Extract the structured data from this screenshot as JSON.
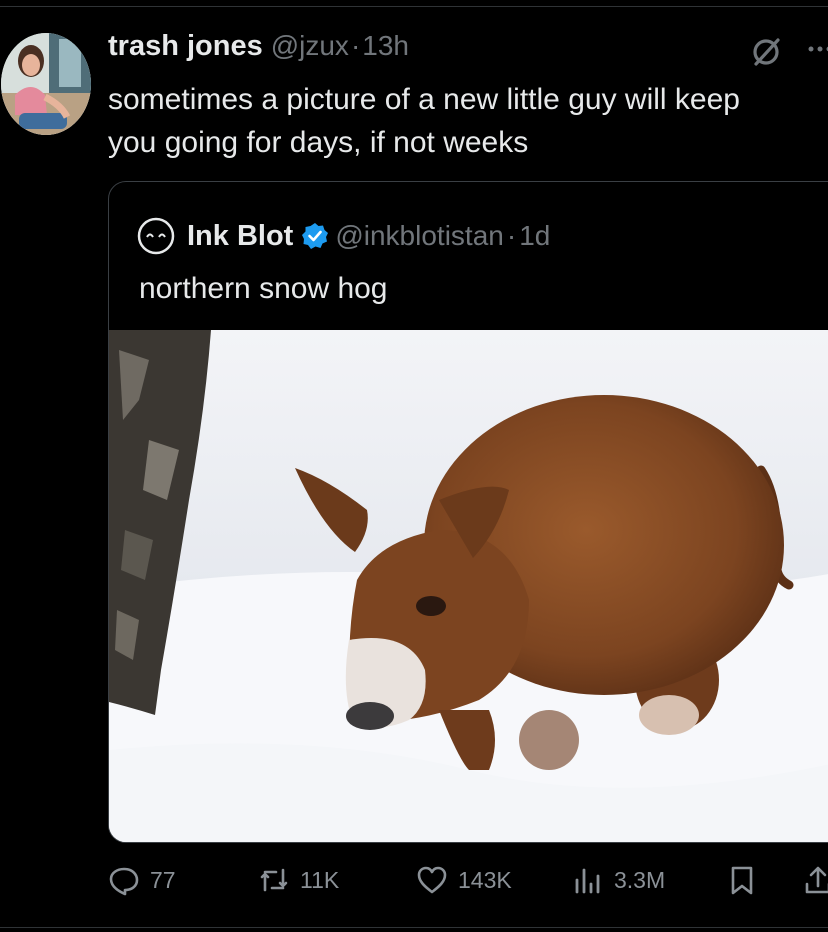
{
  "tweet": {
    "author_name": "trash jones",
    "author_handle": "@jzux",
    "separator": "·",
    "time": "13h",
    "text_line1": "sometimes a picture of a new little guy will keep",
    "text_line2": "you going for days, if not weeks"
  },
  "quote": {
    "name": "Ink Blot",
    "handle": "@inkblotistan",
    "separator": "·",
    "time": "1d",
    "text": "northern snow hog"
  },
  "actions": {
    "replies": "77",
    "reposts": "11K",
    "likes": "143K",
    "views": "3.3M"
  },
  "icons": {
    "reply": "reply-icon",
    "retweet": "retweet-icon",
    "like": "heart-icon",
    "views": "analytics-icon",
    "bookmark": "bookmark-icon",
    "share": "share-icon",
    "grok": "grok-icon",
    "more": "more-icon",
    "verified": "verified-badge-icon"
  },
  "colors": {
    "background": "#000000",
    "text": "#e7e9ea",
    "secondary_text": "#71767b",
    "verified": "#1d9bf0",
    "border": "#2f3336"
  }
}
